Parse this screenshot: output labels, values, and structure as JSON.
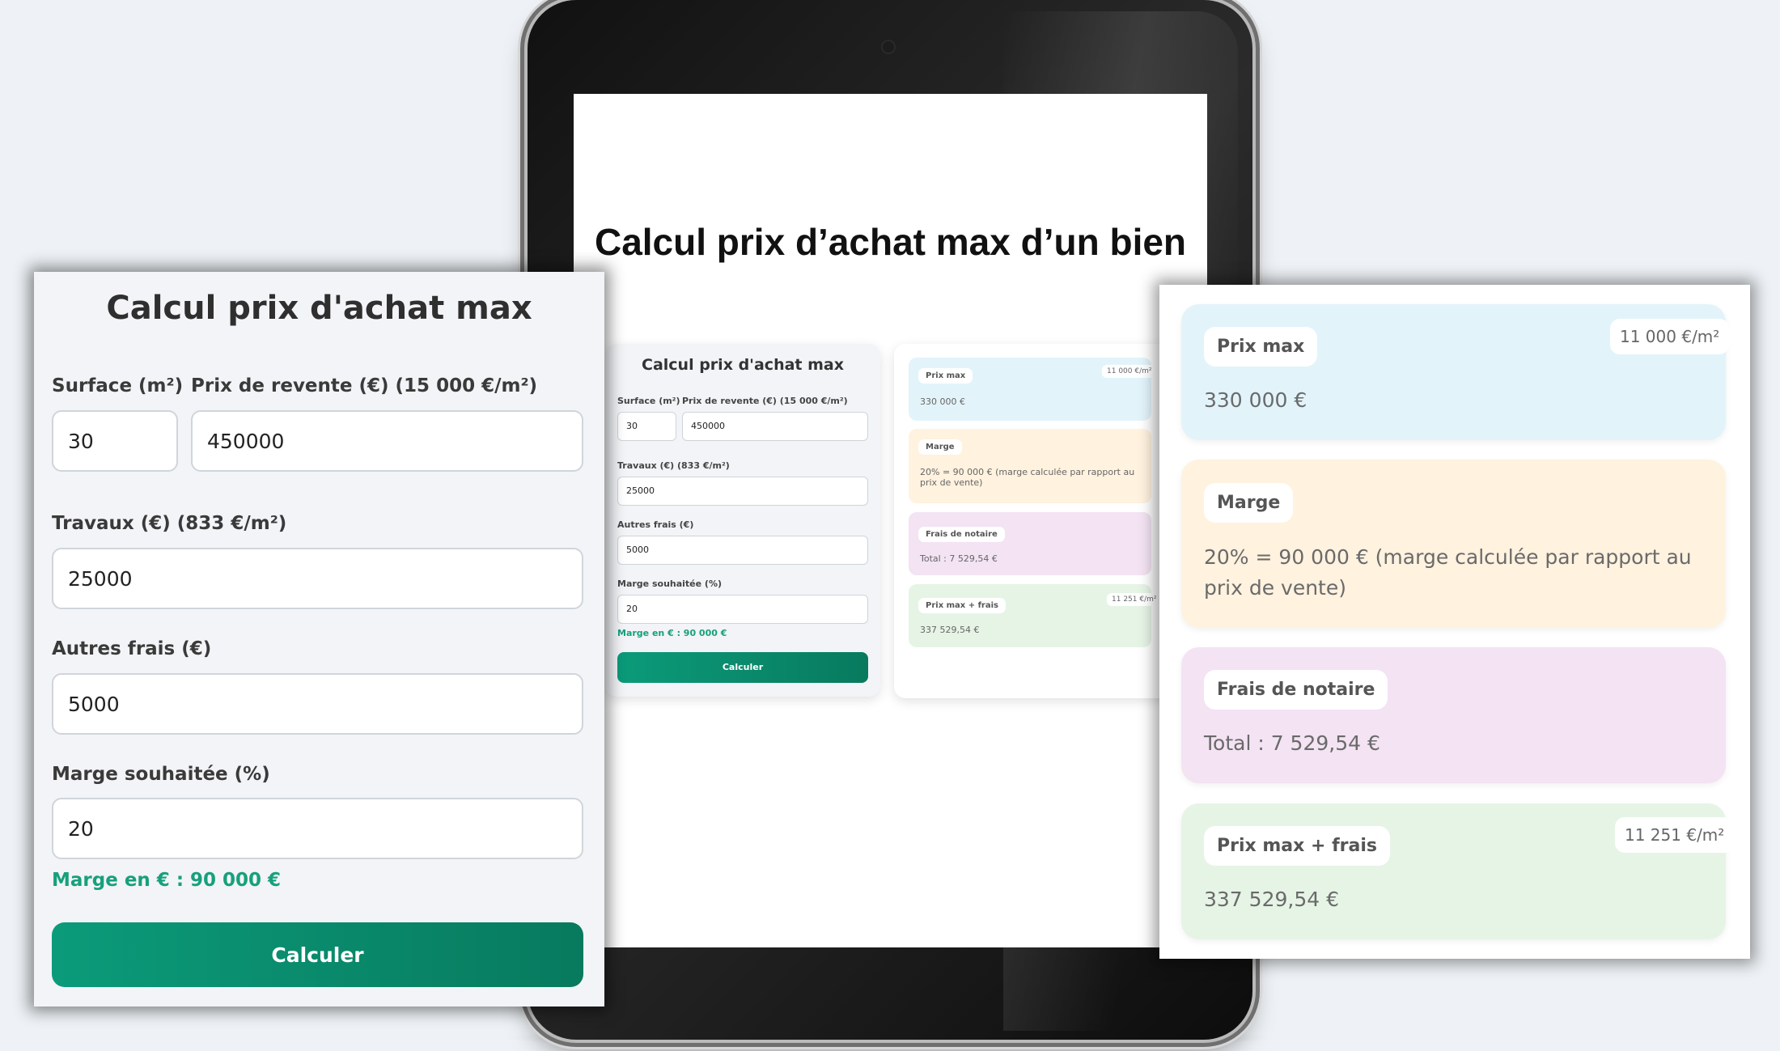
{
  "screen": {
    "title": "Calcul prix d’achat max d’un bien"
  },
  "form": {
    "title": "Calcul prix d'achat max",
    "surface_label": "Surface (m²)",
    "surface_value": "30",
    "prix_revente_label": "Prix de revente (€) (15 000 €/m²)",
    "prix_revente_value": "450000",
    "travaux_label": "Travaux (€) (833 €/m²)",
    "travaux_value": "25000",
    "autres_frais_label": "Autres frais (€)",
    "autres_frais_value": "5000",
    "marge_label": "Marge souhaitée (%)",
    "marge_value": "20",
    "marge_result": "Marge en € : 90 000 €",
    "calculate_button": "Calculer"
  },
  "results": {
    "prix_max": {
      "label": "Prix max",
      "value": "330 000 €",
      "per_m2": "11 000 €/m²",
      "color": "#e2f4fa"
    },
    "marge": {
      "label": "Marge",
      "value": "20% = 90 000 € (marge calculée par rapport au prix de vente)",
      "color": "#fff2df"
    },
    "frais_notaire": {
      "label": "Frais de notaire",
      "value": "Total : 7 529,54 €",
      "color": "#f3e3f3"
    },
    "prix_max_frais": {
      "label": "Prix max + frais",
      "value": "337 529,54 €",
      "per_m2": "11 251 €/m²",
      "color": "#e6f4e6"
    }
  },
  "colors": {
    "accent": "#0b9b7a",
    "marge_text": "#17a07c",
    "form_bg": "#f2f4f7",
    "page_bg": "#eef2f6"
  }
}
